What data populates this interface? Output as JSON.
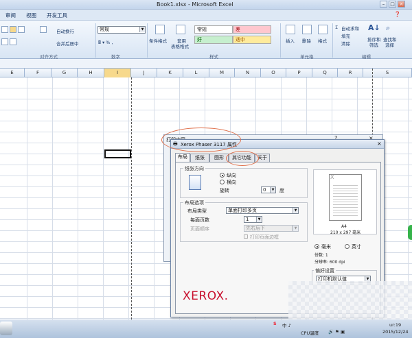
{
  "window": {
    "title": "Book1.xlsx - Microsoft Excel"
  },
  "menu": {
    "items": [
      "审阅",
      "视图",
      "开发工具"
    ]
  },
  "ribbon": {
    "wrap_label": "自动换行",
    "merge_label": "合并后居中",
    "number_format": "常规",
    "cond_format": "条件格式",
    "table_format": "套用",
    "table_format2": "表格格式",
    "style_normal": "常规",
    "style_bad": "差",
    "style_good": "好",
    "style_neutral": "适中",
    "insert": "插入",
    "delete": "删除",
    "format": "格式",
    "autosum": "自动求和",
    "fill": "填充",
    "clear": "清除",
    "sort_filter": "排序和",
    "sort_filter2": "筛选",
    "find_select": "查找和",
    "find_select2": "选择",
    "groups": {
      "alignment": "对齐方式",
      "number": "数字",
      "styles": "样式",
      "cells": "单元格",
      "editing": "编辑"
    }
  },
  "columns": [
    "E",
    "F",
    "G",
    "H",
    "I",
    "J",
    "K",
    "L",
    "M",
    "N",
    "O",
    "P",
    "Q",
    "R",
    "S"
  ],
  "bg_dialog": {
    "title": "打印内容"
  },
  "dialog": {
    "title": "Xerox Phaser 3117 属性",
    "tabs": [
      "布局",
      "纸张",
      "图形",
      "其它功能",
      "关于"
    ],
    "orientation": {
      "legend": "纸张方向",
      "portrait": "纵向",
      "landscape": "横向",
      "rotate_label": "旋转",
      "rotate_value": "0",
      "degree": "度"
    },
    "layout_options": {
      "legend": "布局选项",
      "layout_type_label": "布局类型",
      "layout_type_value": "单面打印多页",
      "pages_per_side_label": "每面页数",
      "pages_per_side_value": "1",
      "page_order_label": "页面顺序",
      "page_order_value": "先右后下",
      "print_border": "打印页面边框"
    },
    "preview": {
      "paper": "A4",
      "size": "210 x 297 毫米"
    },
    "units": {
      "mm": "毫米",
      "inch": "英寸"
    },
    "copies": "份数: 1",
    "resolution": "分辨率: 600 dpi",
    "favorites": {
      "legend": "偏好设置",
      "value": "打印机默认值"
    },
    "brand": "XEROX."
  },
  "taskbar": {
    "cpu": "CPU温度",
    "time": "ur:19",
    "date": "2015/12/24"
  },
  "colors": {
    "accent": "#e0704b",
    "brand": "#c8102e",
    "selected_col": "#f7d98c"
  }
}
